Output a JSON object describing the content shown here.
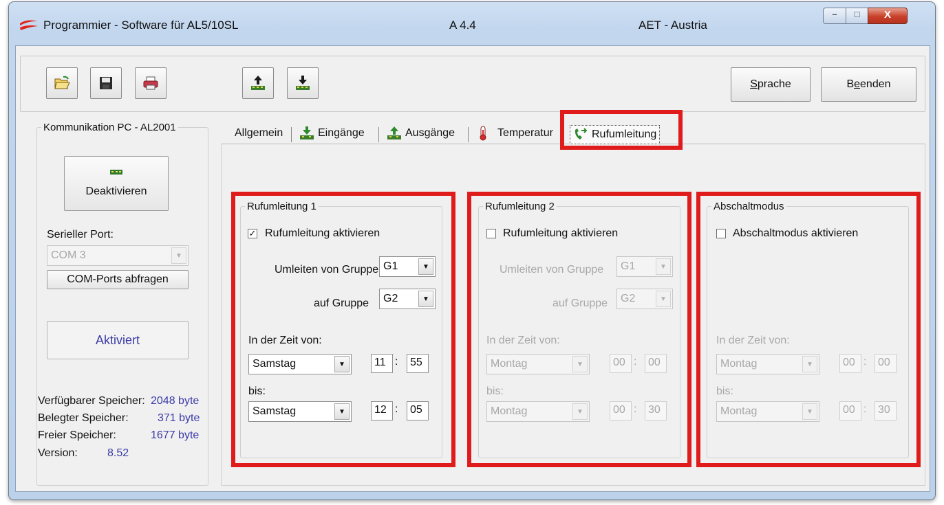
{
  "window": {
    "title": "Programmier - Software für AL5/10SL",
    "version": "A 4.4",
    "company": "AET - Austria",
    "controls": {
      "minimize": "–",
      "maximize": "□",
      "close": "X"
    }
  },
  "toolbar": {
    "icons": [
      "open-folder-icon",
      "save-disk-icon",
      "print-icon",
      "upload-icon",
      "download-icon"
    ],
    "sprache": {
      "underlined": "S",
      "rest": "prache"
    },
    "beenden": {
      "pre": "B",
      "underlined": "e",
      "rest": "enden"
    }
  },
  "komm": {
    "legend": "Kommunikation PC - AL2001",
    "deaktivieren": "Deaktivieren",
    "port_label": "Serieller Port:",
    "port_value": "COM 3",
    "abfragen": "COM-Ports abfragen",
    "aktiviert": "Aktiviert",
    "stats": [
      {
        "label": "Verfügbarer Speicher:",
        "value": "2048 byte"
      },
      {
        "label": "Belegter Speicher:",
        "value": "371 byte"
      },
      {
        "label": "Freier Speicher:",
        "value": "1677 byte"
      },
      {
        "label": "Version:",
        "value": "8.52"
      }
    ]
  },
  "tabs": [
    "Allgemein",
    "Eingänge",
    "Ausgänge",
    "Temperatur",
    "Rufumleitung"
  ],
  "ruf1": {
    "legend": "Rufumleitung 1",
    "checkbox_label": "Rufumleitung aktivieren",
    "checked": true,
    "von_label": "Umleiten von Gruppe",
    "von_value": "G1",
    "auf_label": "auf Gruppe",
    "auf_value": "G2",
    "zeit_label": "In der Zeit von:",
    "from_day": "Samstag",
    "from_h": "11",
    "from_m": "55",
    "bis_label": "bis:",
    "to_day": "Samstag",
    "to_h": "12",
    "to_m": "05"
  },
  "ruf2": {
    "legend": "Rufumleitung 2",
    "checkbox_label": "Rufumleitung aktivieren",
    "checked": false,
    "von_label": "Umleiten von Gruppe",
    "von_value": "G1",
    "auf_label": "auf Gruppe",
    "auf_value": "G2",
    "zeit_label": "In der Zeit von:",
    "from_day": "Montag",
    "from_h": "00",
    "from_m": "00",
    "bis_label": "bis:",
    "to_day": "Montag",
    "to_h": "00",
    "to_m": "30"
  },
  "abschalt": {
    "legend": "Abschaltmodus",
    "checkbox_label": "Abschaltmodus aktivieren",
    "checked": false,
    "zeit_label": "In der Zeit von:",
    "from_day": "Montag",
    "from_h": "00",
    "from_m": "00",
    "bis_label": "bis:",
    "to_day": "Montag",
    "to_h": "00",
    "to_m": "30"
  },
  "colors": {
    "highlight": "#e01b1b",
    "value_blue": "#3a3aa8",
    "disabled_text": "#a8a8a8"
  }
}
